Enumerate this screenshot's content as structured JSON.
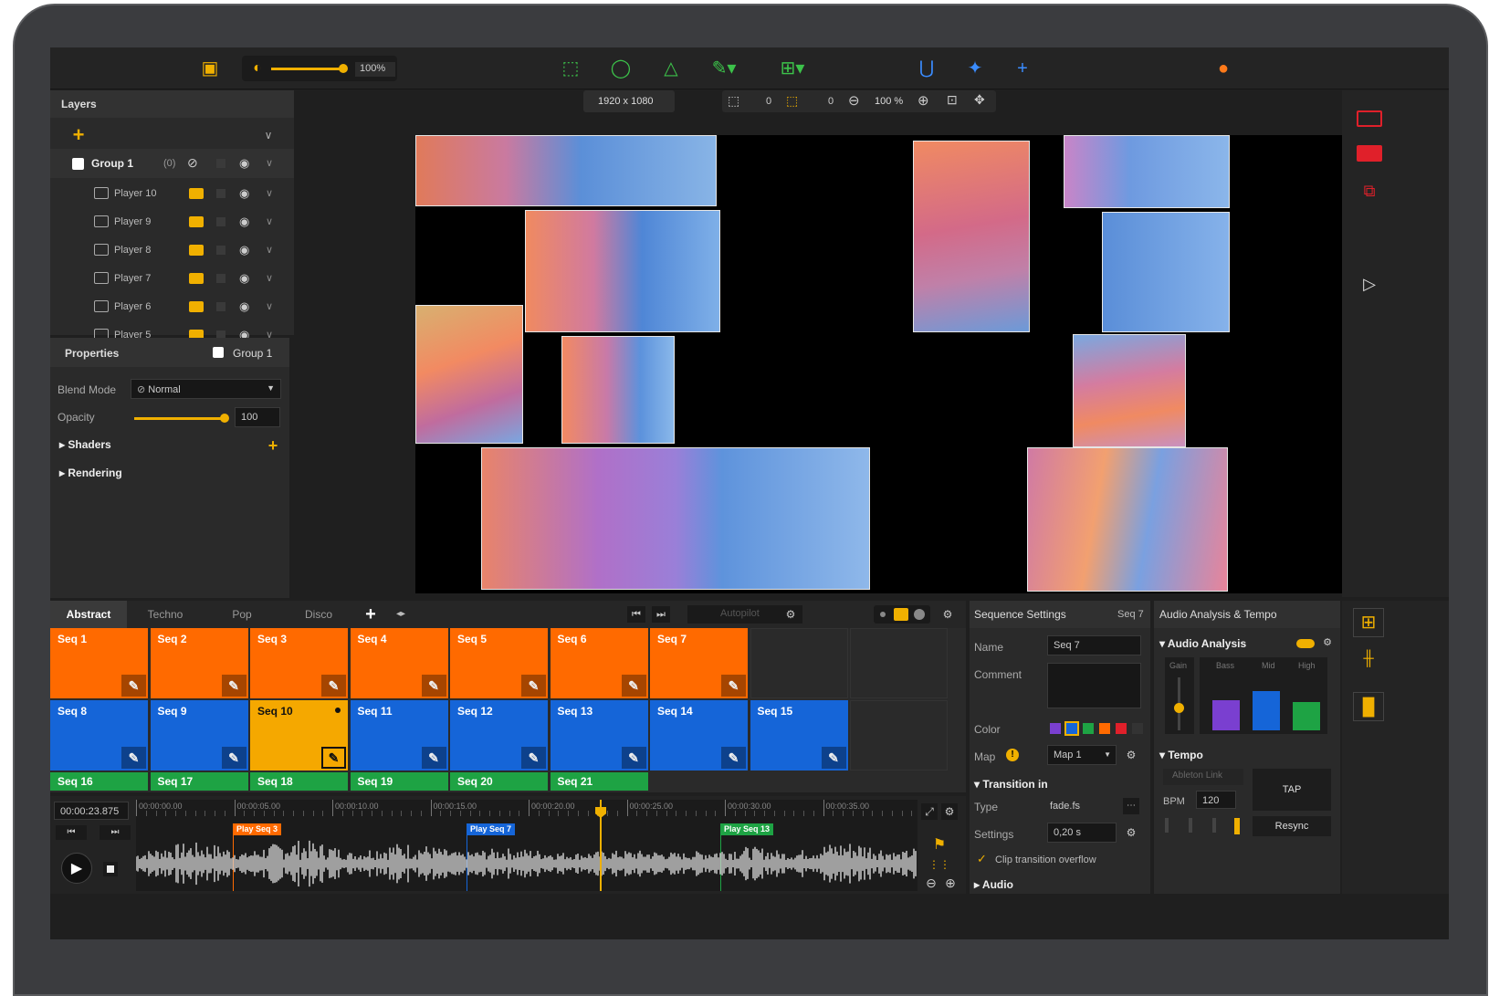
{
  "topbar": {
    "zoom_value": "100%"
  },
  "canvas_toolbar": {
    "resolution": "1920 x 1080",
    "val_a": "0",
    "val_b": "0",
    "zoom": "100 %"
  },
  "layers": {
    "title": "Layers",
    "group": {
      "name": "Group 1",
      "count": "(0)"
    },
    "items": [
      {
        "label": "Player 10"
      },
      {
        "label": "Player 9"
      },
      {
        "label": "Player 8"
      },
      {
        "label": "Player 7"
      },
      {
        "label": "Player 6"
      },
      {
        "label": "Player 5"
      }
    ]
  },
  "properties": {
    "title": "Properties",
    "group_label": "Group 1",
    "blend_mode_label": "Blend Mode",
    "blend_mode_value": "Normal",
    "opacity_label": "Opacity",
    "opacity_value": "100",
    "opacity_fraction": 1.0,
    "shaders_label": "Shaders",
    "rendering_label": "Rendering"
  },
  "sequence_tabs": {
    "tabs": [
      "Abstract",
      "Techno",
      "Pop",
      "Disco"
    ],
    "autopilot": "Autopilot"
  },
  "sequences": {
    "row1": [
      "Seq 1",
      "Seq 2",
      "Seq 3",
      "Seq 4",
      "Seq 5",
      "Seq 6",
      "Seq 7"
    ],
    "row2": [
      "Seq 8",
      "Seq 9",
      "Seq 10",
      "Seq 11",
      "Seq 12",
      "Seq 13",
      "Seq 14",
      "Seq 15"
    ],
    "row3": [
      "Seq 16",
      "Seq 17",
      "Seq 18",
      "Seq 19",
      "Seq 20",
      "Seq 21"
    ],
    "colors": {
      "orange": "#ff6a00",
      "blue": "#1565d8",
      "yellow": "#f5a800",
      "green": "#1ea344"
    }
  },
  "timeline": {
    "timecode": "00:00:23.875",
    "ticks": [
      "00:00:00.00",
      "00:00:05.00",
      "00:00:10.00",
      "00:00:15.00",
      "00:00:20.00",
      "00:00:25.00",
      "00:00:30.00",
      "00:00:35.00"
    ],
    "markers": [
      "Play Seq 3",
      "Play Seq 7",
      "Play Seq 13"
    ]
  },
  "sequence_settings": {
    "title": "Sequence Settings",
    "seq_tag": "Seq 7",
    "name_label": "Name",
    "name_value": "Seq 7",
    "comment_label": "Comment",
    "color_label": "Color",
    "map_label": "Map",
    "map_value": "Map 1",
    "transition_label": "Transition in",
    "type_label": "Type",
    "type_value": "fade.fs",
    "settings_label": "Settings",
    "settings_value": "0,20 s",
    "clip_label": "Clip transition overflow",
    "audio_label": "Audio",
    "swatches": [
      "#7a3fd0",
      "#1565d8",
      "#1ea344",
      "#ff6a00",
      "#e0202a",
      "#333333"
    ]
  },
  "audio_analysis": {
    "title": "Audio Analysis & Tempo",
    "section": "Audio Analysis",
    "gain": "Gain",
    "bass": "Bass",
    "mid": "Mid",
    "high": "High",
    "bass_level": 0.55,
    "mid_level": 0.72,
    "high_level": 0.52,
    "tempo": "Tempo",
    "ableton": "Ableton Link",
    "tap": "TAP",
    "bpm_label": "BPM",
    "bpm_value": "120",
    "resync": "Resync"
  }
}
